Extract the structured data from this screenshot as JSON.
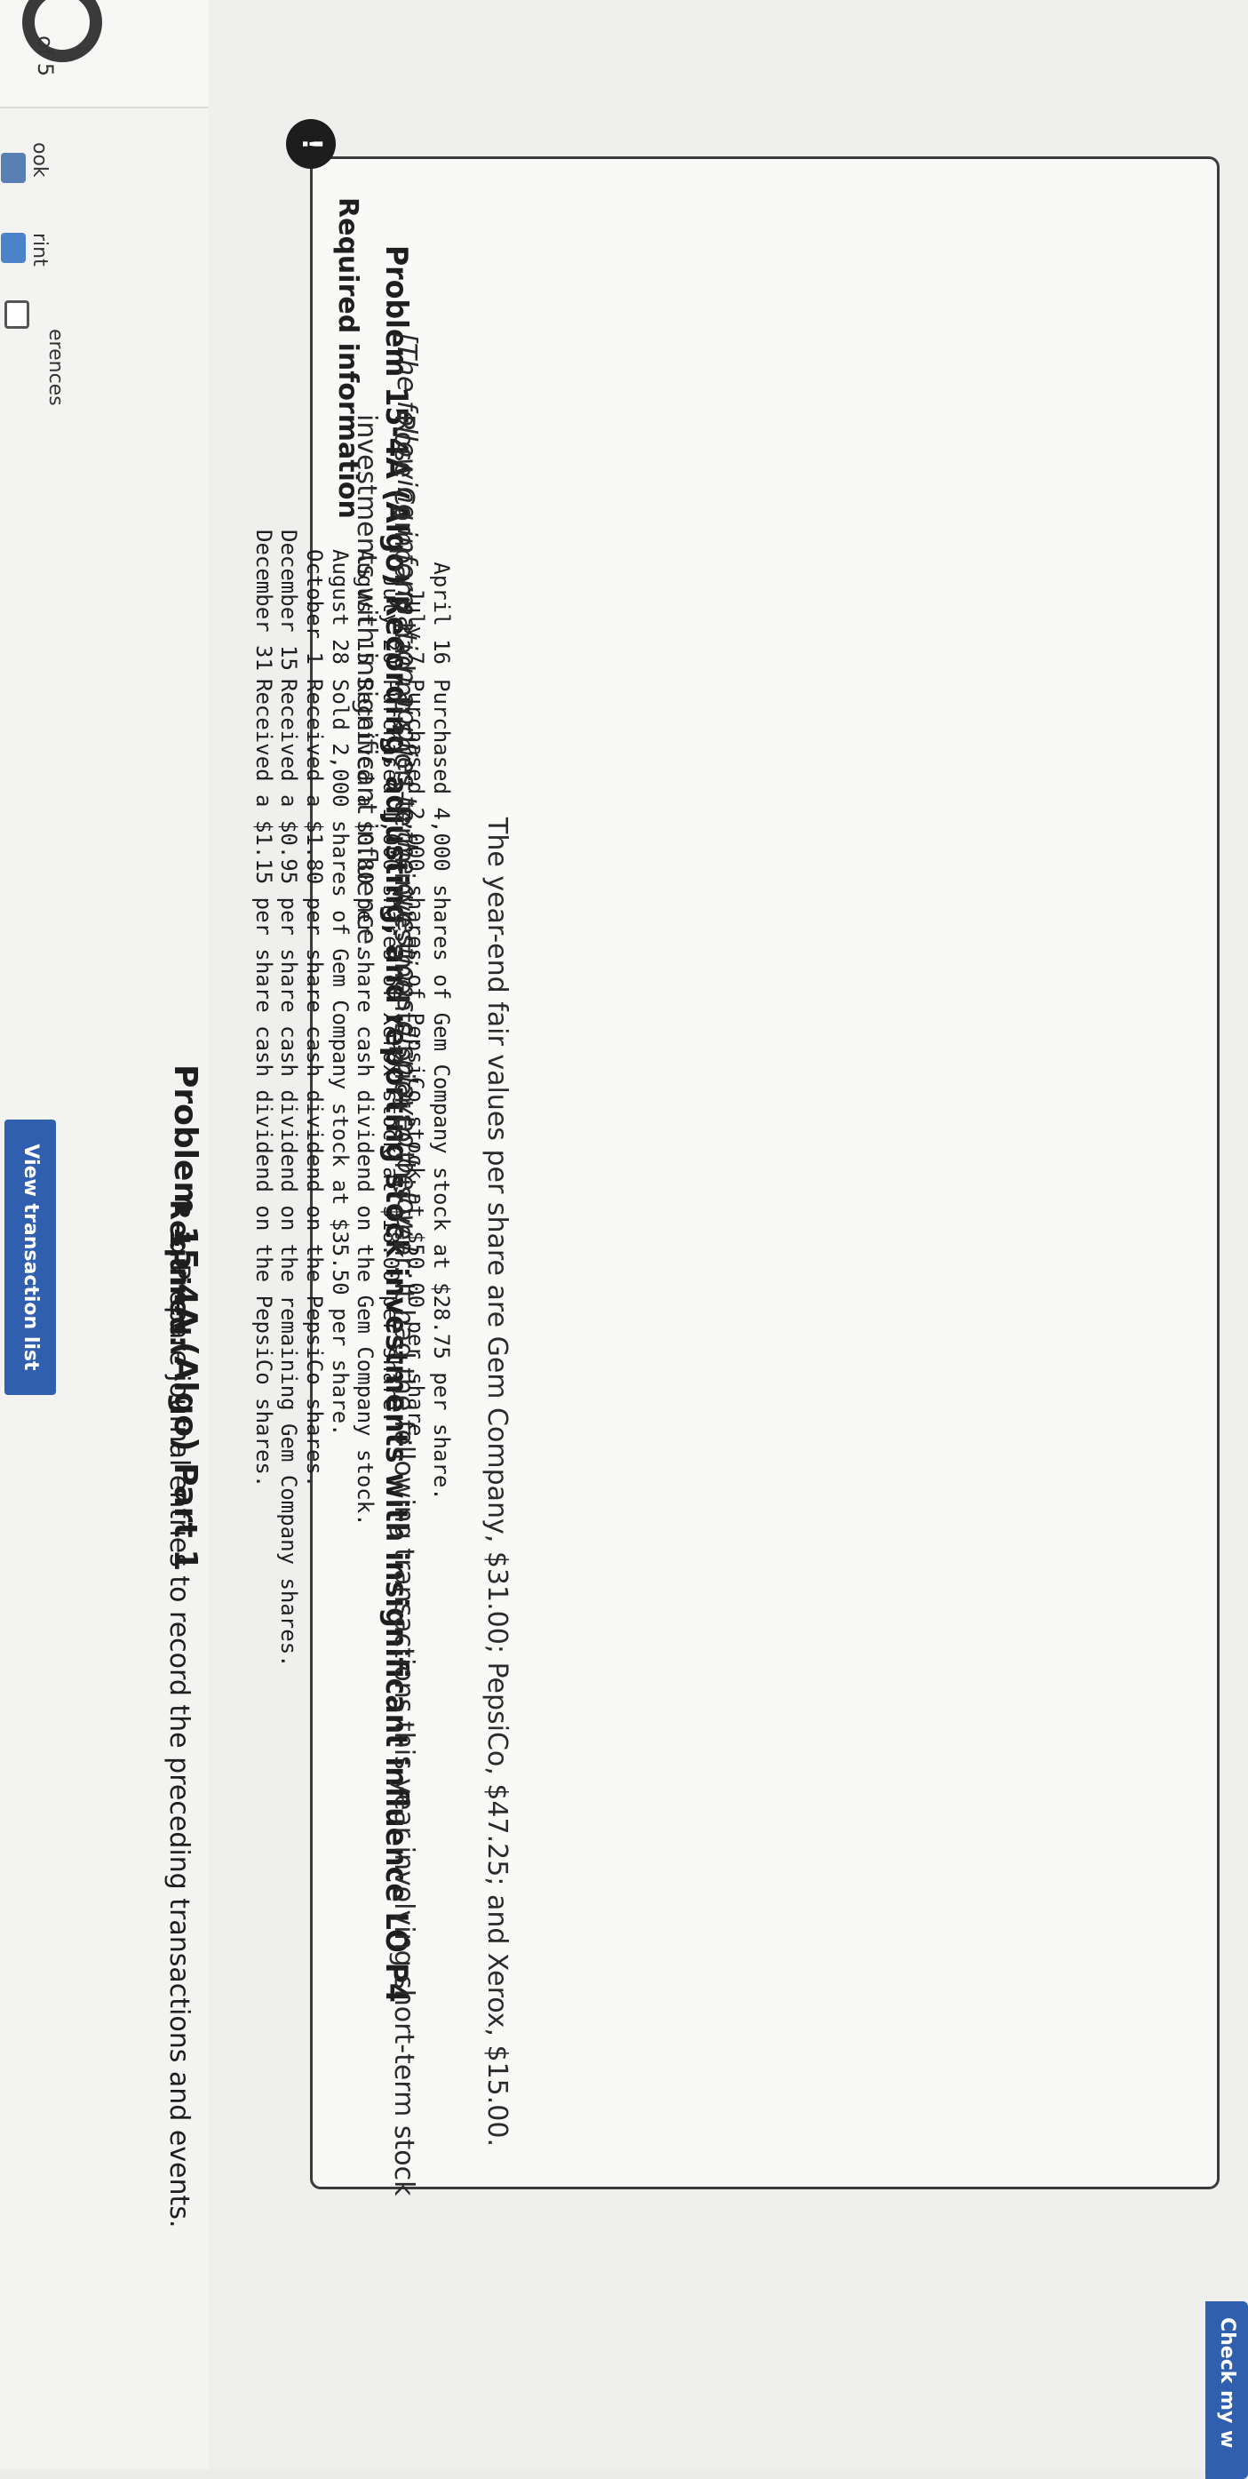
{
  "sidebar": {
    "page_indicator": "of 5",
    "items": [
      {
        "label": "ook",
        "icon": "ebook-icon"
      },
      {
        "label": "rint",
        "icon": "print-icon"
      },
      {
        "label": "erences",
        "icon": "references-icon"
      }
    ]
  },
  "header": {
    "alert_symbol": "!",
    "required_info": "Required information"
  },
  "problem": {
    "title": "Problem 15-4A (Algo) Recording, adjusting, and reporting stock investments with insignificant influence LO P4",
    "note": "[The following information applies to the questions displayed below.]",
    "intro": "Rose Company had no short-term investments prior to this year. It had the following transactions this year involving short-term stock investments with insignificant influence.",
    "transactions": [
      {
        "date": "April 16",
        "description": "Purchased 4,000 shares of Gem Company stock at $28.75 per share."
      },
      {
        "date": "July 7",
        "description": "Purchased 2,000 shares of PepsiCo stock at $50.00 per share."
      },
      {
        "date": "July 20",
        "description": "Purchased 1,000 shares of Xerox stock at $18.00 per share."
      },
      {
        "date": "August 15",
        "description": "Received a $0.80 per share cash dividend on the Gem Company stock."
      },
      {
        "date": "August 28",
        "description": "Sold 2,000 shares of Gem Company stock at $35.50 per share."
      },
      {
        "date": "October 1",
        "description": "Received a $1.80 per share cash dividend on the PepsiCo shares."
      },
      {
        "date": "December 15",
        "description": "Received a $0.95 per share cash dividend on the remaining Gem Company shares."
      },
      {
        "date": "December 31",
        "description": "Received a $1.15 per share cash dividend on the PepsiCo shares."
      }
    ],
    "fair_values": "The year-end fair values per share are Gem Company, $31.00; PepsiCo, $47.25; and Xerox, $15.00."
  },
  "part": {
    "title": "Problem 15-4A (Algo) Part 1",
    "required_label": "Required:",
    "item_number": "1.",
    "item_text": "Prepare journal entries to record the preceding transactions and events."
  },
  "buttons": {
    "view_transactions": "View transaction list",
    "check_work": "Check my w"
  },
  "colors": {
    "accent": "#2f5fae",
    "card_border": "#3b3b3b",
    "background": "#efefed"
  }
}
